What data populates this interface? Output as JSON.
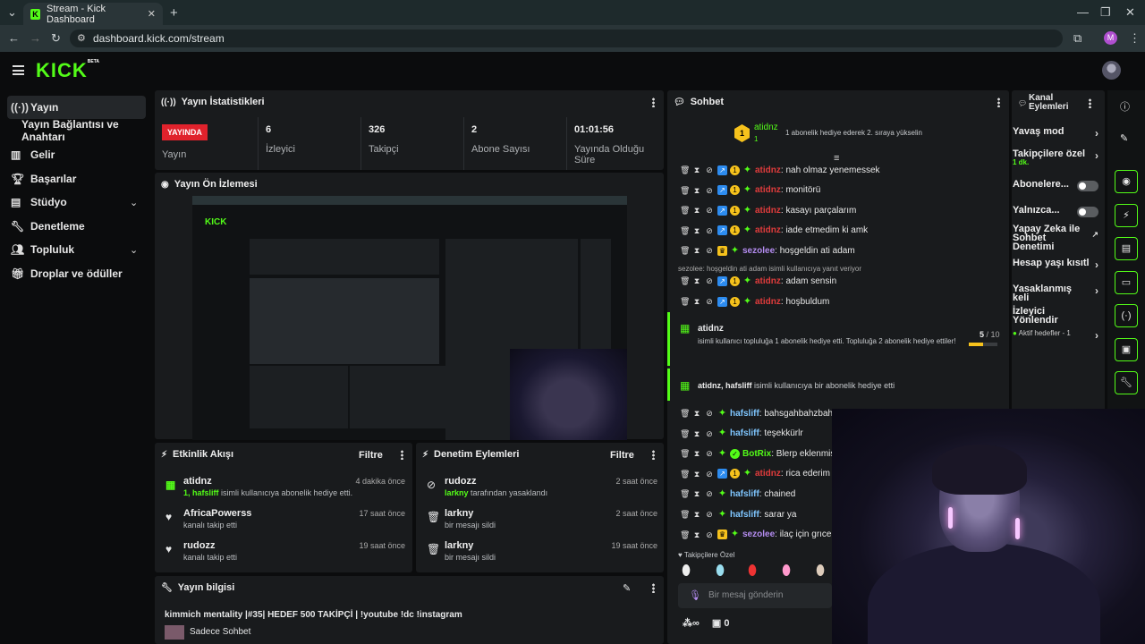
{
  "browser": {
    "tab_title": "Stream - Kick Dashboard",
    "url": "dashboard.kick.com/stream",
    "profile_initial": "M"
  },
  "app": {
    "logo": "KICK",
    "beta": "BETA"
  },
  "nav": {
    "items": [
      {
        "label": "Yayın",
        "icon": "broadcast-icon"
      },
      {
        "label": "Yayın Bağlantısı ve Anahtarı",
        "icon": ""
      },
      {
        "label": "Gelir",
        "icon": "chart-icon"
      },
      {
        "label": "Başarılar",
        "icon": "trophy-icon"
      },
      {
        "label": "Stüdyo",
        "icon": "studio-icon"
      },
      {
        "label": "Denetleme",
        "icon": "wrench-icon"
      },
      {
        "label": "Topluluk",
        "icon": "community-icon"
      },
      {
        "label": "Droplar ve ödüller",
        "icon": "gift-icon"
      }
    ]
  },
  "stats": {
    "title": "Yayın İstatistikleri",
    "live_badge": "YAYINDA",
    "live_label": "Yayın",
    "items": [
      {
        "value": "6",
        "label": "İzleyici"
      },
      {
        "value": "326",
        "label": "Takipçi"
      },
      {
        "value": "2",
        "label": "Abone Sayısı"
      },
      {
        "value": "01:01:56",
        "label": "Yayında Olduğu Süre"
      }
    ]
  },
  "preview": {
    "title": "Yayın Ön İzlemesi"
  },
  "activity": {
    "title": "Etkinlik Akışı",
    "filter": "Filtre",
    "events": [
      {
        "name": "atidnz",
        "sub_prefix": "1, hafsliff",
        "sub": " isimli kullanıcıya abonelik hediye etti.",
        "time": "4 dakika önce",
        "icon": "gift-icon"
      },
      {
        "name": "AfricaPowerss",
        "sub_prefix": "",
        "sub": "kanalı takip etti",
        "time": "17 saat önce",
        "icon": "heart-icon"
      },
      {
        "name": "rudozz",
        "sub_prefix": "",
        "sub": "kanalı takip etti",
        "time": "19 saat önce",
        "icon": "heart-icon"
      }
    ]
  },
  "moderation": {
    "title": "Denetim Eylemleri",
    "filter": "Filtre",
    "events": [
      {
        "name": "rudozz",
        "sub_prefix": "larkny",
        "sub": " tarafından yasaklandı",
        "time": "2 saat önce",
        "icon": "ban-icon"
      },
      {
        "name": "larkny",
        "sub_prefix": "",
        "sub": "bir mesajı sildi",
        "time": "2 saat önce",
        "icon": "trash-icon"
      },
      {
        "name": "larkny",
        "sub_prefix": "",
        "sub": "bir mesajı sildi",
        "time": "19 saat önce",
        "icon": "trash-icon"
      }
    ]
  },
  "info": {
    "title": "Yayın bilgisi",
    "stream_title": "kimmich mentality |#35| HEDEF 500 TAKİPÇİ | !youtube !dc !instagram",
    "category": "Sadece Sohbet"
  },
  "chat": {
    "title": "Sohbet",
    "pinned_user": "atidnz",
    "pinned_count": "1",
    "pinned_text": "1 abonelik hediye ederek 2. sıraya yükselin",
    "messages": [
      {
        "user": "atidnz",
        "text": ": nah olmaz yenemessek",
        "cls": "red",
        "crown": false
      },
      {
        "user": "atidnz",
        "text": ": monitörü",
        "cls": "red",
        "crown": false
      },
      {
        "user": "atidnz",
        "text": ": kasayı parçalarım",
        "cls": "red",
        "crown": false
      },
      {
        "user": "atidnz",
        "text": ": iade etmedim ki amk",
        "cls": "red",
        "crown": false
      },
      {
        "user": "sezolee",
        "text": ": hoşgeldin ati adam",
        "cls": "pur",
        "crown": true
      }
    ],
    "reply_note": "sezolee: hoşgeldin ati adam isimli kullanıcıya yanıt veriyor",
    "messages2": [
      {
        "user": "atidnz",
        "text": ": adam sensin",
        "cls": "red"
      },
      {
        "user": "atidnz",
        "text": ": hoşbuldum",
        "cls": "red"
      }
    ],
    "gift1": {
      "user": "atidnz",
      "text": "isimli kullanıcı topluluğa 1 abonelik hediye etti. Topluluğa 2 abonelik hediye ettiler!",
      "progress": "5",
      "total": "/ 10",
      "fraction": 0.5
    },
    "gift2": {
      "users": "atidnz, hafsliff",
      "text": " isimli kullanıcıya bir abonelik hediye etti"
    },
    "messages3": [
      {
        "user": "hafsliff",
        "text": ": bahsgahbahzbahz",
        "cls": "blu",
        "badge": "none"
      },
      {
        "user": "hafsliff",
        "text": ": teşekkürlr",
        "cls": "blu",
        "badge": "none"
      },
      {
        "user": "BotRix",
        "text": ": Blerp eklenmiş",
        "cls": "grn",
        "badge": "bot"
      },
      {
        "user": "atidnz",
        "text": ": rica ederim",
        "cls": "red",
        "badge": "sub"
      },
      {
        "user": "hafsliff",
        "text": ": chained",
        "cls": "blu",
        "badge": "none"
      },
      {
        "user": "hafsliff",
        "text": ": sarar ya",
        "cls": "blu",
        "badge": "none"
      },
      {
        "user": "sezolee",
        "text": ": ilaç için grıcer",
        "cls": "pur",
        "badge": "crown"
      }
    ],
    "emote_label": "Takipçilere Özel",
    "input_placeholder": "Bir mesaj gönderin",
    "footer_infinity": "∞",
    "footer_count": "0"
  },
  "channel": {
    "title": "Kanal Eylemleri",
    "items": [
      {
        "label": "Yavaş mod",
        "sub": "",
        "type": "arrow"
      },
      {
        "label": "Takipçilere özel",
        "sub": "1 dk.",
        "type": "arrow"
      },
      {
        "label": "Abonelere...",
        "sub": "",
        "type": "toggle"
      },
      {
        "label": "Yalnızca...",
        "sub": "",
        "type": "toggle"
      },
      {
        "label": "Yapay Zeka ile Sohbet Denetimi",
        "sub": "",
        "type": "link"
      },
      {
        "label": "Hesap yaşı kısıtl",
        "sub": "",
        "type": "arrow"
      },
      {
        "label": "Yasaklanmış keli",
        "sub": "",
        "type": "arrow"
      },
      {
        "label": "İzleyici Yönlendir",
        "sub": "",
        "type": "none"
      },
      {
        "label": "Aktif hedefler - 1",
        "sub": "",
        "type": "arrow"
      }
    ]
  },
  "colors": {
    "accent": "#53fc18",
    "live": "#e0222c",
    "panel": "#191b1d"
  }
}
